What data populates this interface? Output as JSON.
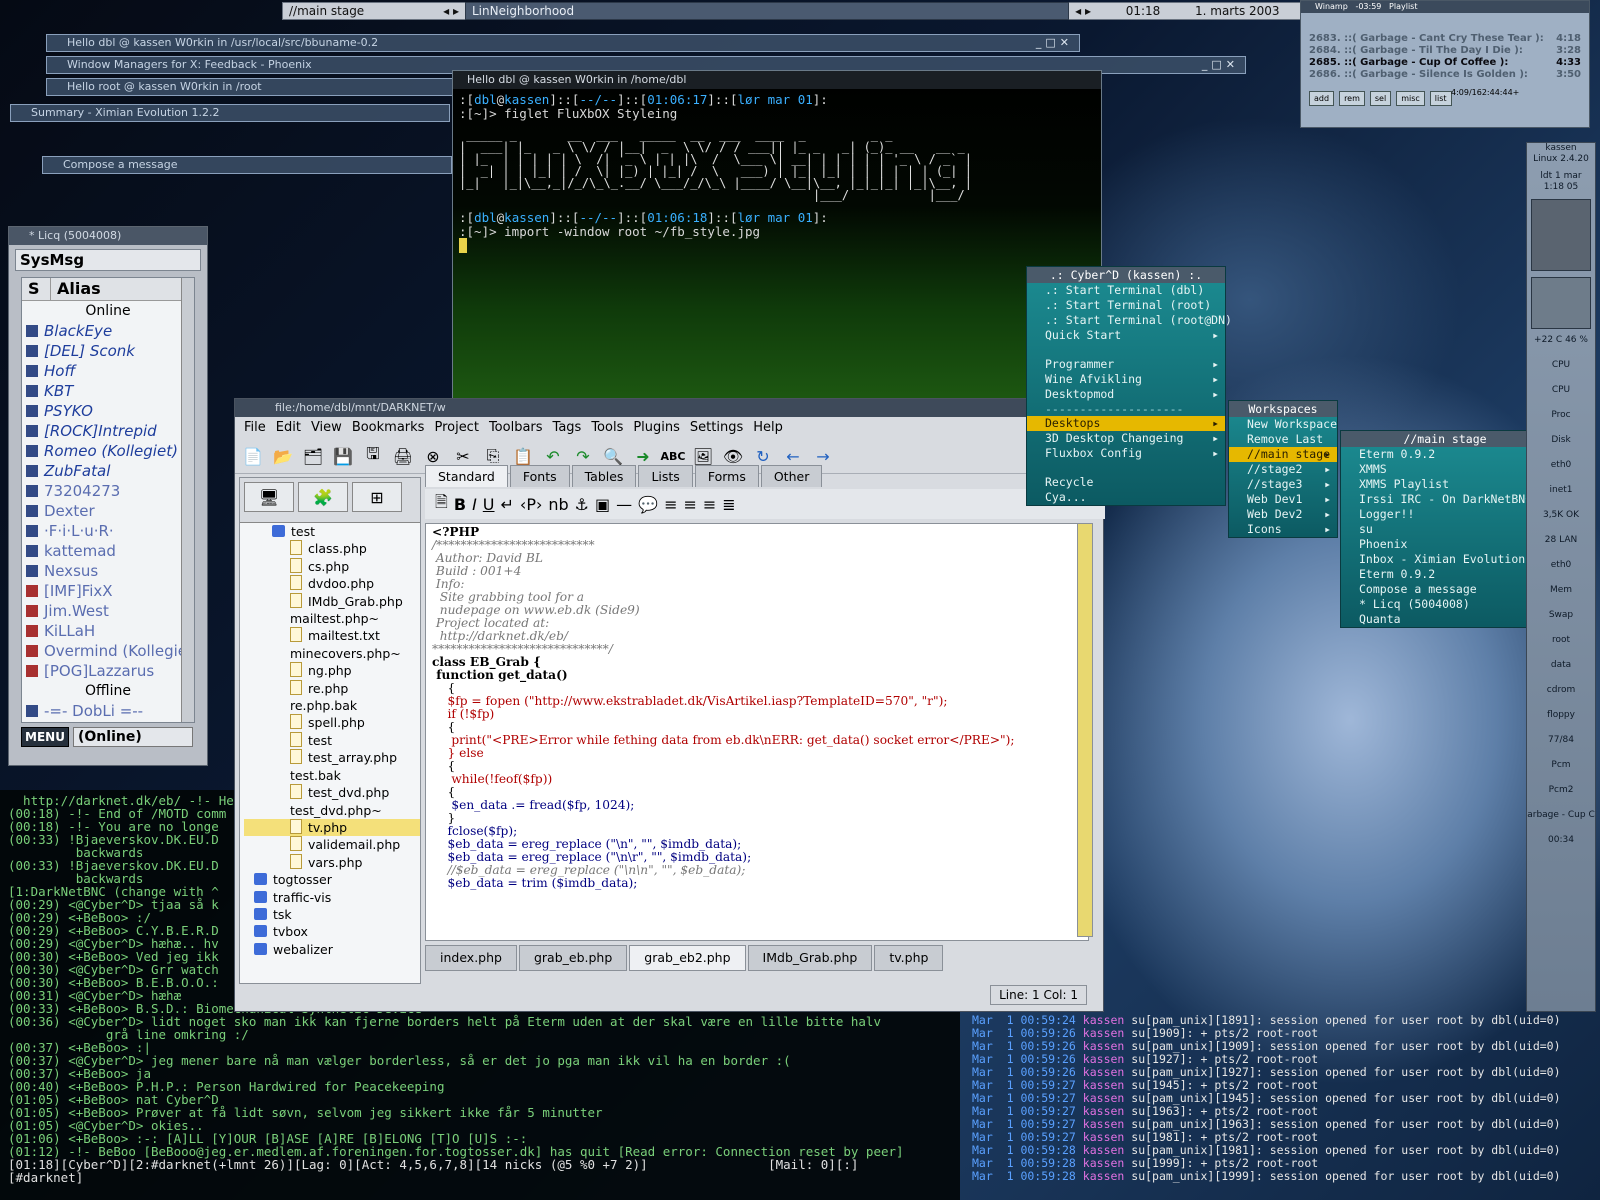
{
  "topbar": {
    "workspace": "//main stage",
    "left_arrow": "◂",
    "right_arrow": "▸",
    "window": "LinNeighborhood",
    "clock": "01:18",
    "date": "1. marts 2003"
  },
  "minimized": [
    "Hello dbl @ kassen W0rkin in  /usr/local/src/bbuname-0.2",
    "Window Managers for X: Feedback - Phoenix",
    "Hello root @ kassen W0rkin in  /root",
    "Summary - Ximian Evolution 1.2.2",
    "Compose a message"
  ],
  "terminal": {
    "title": "Hello dbl @ kassen W0rkin in  /home/dbl",
    "prompt1_user": "dbl",
    "prompt1_host": "kassen",
    "prompt1_dir": "--/--",
    "prompt1_time": "01:06:17",
    "prompt1_date": "lør mar 01",
    "cmd1": "figlet FluXbOX Styleing",
    "figlet": [
      " _____ _       __  ___   _____  __  ___  ____  _         _ _             ",
      "|  ___| |_   _ \\ \\/ / |__|  _  \\ \\/ / / ___|| |_ _   _| (_)_ __   __ _ ",
      "| |_  | | | | | \\  /| '_ \\ | | |\\  /  \\___ \\| __| | | | | | '_ \\ / _` |",
      "|  _| | | |_| | /  \\| |_) | |_| /  \\   ___) | |_| |_| | | | | | | (_| |",
      "|_|   |_|\\__,_|/_/\\_\\_.__/ \\___/_/\\_\\ |____/ \\__|\\__, |_|_|_| |_|\\__, |",
      "                                                 |___/           |___/ "
    ],
    "prompt2_time": "01:06:18",
    "cmd2": "import -window root ~/fb_style.jpg"
  },
  "licq": {
    "title": "* Licq (5004008)",
    "sysmsg": "SysMsg",
    "col_s": "S",
    "col_alias": "Alias",
    "online_label": "Online",
    "online": [
      "BlackEye",
      "[DEL] Sconk",
      "Hoff",
      "KBT",
      "PSYKO",
      "[ROCK]Intrepid",
      "Romeo (Kollegiet)",
      "ZubFatal"
    ],
    "offline_top": [
      "73204273",
      "Dexter",
      "·F·i·L·u·R·",
      "kattemad",
      "Nexsus",
      "[IMF]FixX",
      "Jim.West",
      "KiLLaH",
      "Overmind (Kollegie",
      "[POG]Lazzarus"
    ],
    "offline_label": "Offline",
    "offline": [
      "-=- DobLi =--"
    ],
    "menu": "MENU",
    "status": "(Online)"
  },
  "irc": {
    "lines": [
      "  http://darknet.dk/eb/ -!- He",
      "(00:18) -!- End of /MOTD comm",
      "(00:18) -!- You are no longe",
      "(00:33) !Bjaeverskov.DK.EU.D",
      "         backwards",
      "(00:33) !Bjaeverskov.DK.EU.D",
      "         backwards",
      "[1:DarkNetBNC (change with ^",
      "(00:29) <@Cyber^D> tjaa så k",
      "(00:29) <+BeBoo> :/",
      "(00:29) <+BeBoo> C.Y.B.E.R.D",
      "(00:29) <@Cyber^D> hæhæ.. hv",
      "(00:30) <+BeBoo> Ved jeg ikk",
      "(00:30) <@Cyber^D> Grr watch",
      "(00:30) <+BeBoo> B.E.B.O.O.:",
      "(00:31) <@Cyber^D> hæhæ",
      "(00:33) <+BeBoo> B.S.D.: Biomechanical Synthetic Device",
      "(00:36) <@Cyber^D> lidt noget sko man ikk kan fjerne borders helt på Eterm uden at der skal være en lille bitte halv",
      "             grå line omkring :/",
      "(00:37) <+BeBoo> :|",
      "(00:37) <@Cyber^D> jeg mener bare nå man vælger borderless, så er det jo pga man ikk vil ha en border :(",
      "(00:37) <+BeBoo> ja",
      "(00:40) <+BeBoo> P.H.P.: Person Hardwired for Peacekeeping",
      "(01:05) <+BeBoo> nat Cyber^D",
      "(01:05) <+BeBoo> Prøver at få lidt søvn, selvom jeg sikkert ikke får 5 minutter",
      "(01:05) <@Cyber^D> okies..",
      "(01:06) <+BeBoo> :-: [A]LL [Y]OUR [B]ASE [A]RE [B]ELONG [T]O [U]S :-:",
      "(01:12) -!- BeBoo [BeBooo@jeg.er.medlem.af.foreningen.for.togtosser.dk] has quit [Read error: Connection reset by peer]",
      "[01:18][Cyber^D][2:#darknet(+lmnt 26)][Lag: 0][Act: 4,5,6,7,8][14 nicks (@5 %0 +7 2)]                [Mail: 0][:]",
      "[#darknet] "
    ]
  },
  "syslog": {
    "lines": [
      {
        "d": "Mar  1 00:59:24",
        "h": "kassen",
        "p": " su[pam_unix][1891]: session opened for user root by dbl(uid=0)"
      },
      {
        "d": "Mar  1 00:59:26",
        "h": "kassen",
        "p": " su[1909]: + pts/2 root-root"
      },
      {
        "d": "Mar  1 00:59:26",
        "h": "kassen",
        "p": " su[pam_unix][1909]: session opened for user root by dbl(uid=0)"
      },
      {
        "d": "Mar  1 00:59:26",
        "h": "kassen",
        "p": " su[1927]: + pts/2 root-root"
      },
      {
        "d": "Mar  1 00:59:26",
        "h": "kassen",
        "p": " su[pam_unix][1927]: session opened for user root by dbl(uid=0)"
      },
      {
        "d": "Mar  1 00:59:27",
        "h": "kassen",
        "p": " su[1945]: + pts/2 root-root"
      },
      {
        "d": "Mar  1 00:59:27",
        "h": "kassen",
        "p": " su[pam_unix][1945]: session opened for user root by dbl(uid=0)"
      },
      {
        "d": "Mar  1 00:59:27",
        "h": "kassen",
        "p": " su[1963]: + pts/2 root-root"
      },
      {
        "d": "Mar  1 00:59:27",
        "h": "kassen",
        "p": " su[pam_unix][1963]: session opened for user root by dbl(uid=0)"
      },
      {
        "d": "Mar  1 00:59:27",
        "h": "kassen",
        "p": " su[1981]: + pts/2 root-root"
      },
      {
        "d": "Mar  1 00:59:28",
        "h": "kassen",
        "p": " su[pam_unix][1981]: session opened for user root by dbl(uid=0)"
      },
      {
        "d": "Mar  1 00:59:28",
        "h": "kassen",
        "p": " su[1999]: + pts/2 root-root"
      },
      {
        "d": "Mar  1 00:59:28",
        "h": "kassen",
        "p": " su[pam_unix][1999]: session opened for user root by dbl(uid=0)"
      }
    ]
  },
  "bluefish": {
    "title": "file:/home/dbl/mnt/DARKNET/w",
    "menus": [
      "File",
      "Edit",
      "View",
      "Bookmarks",
      "Project",
      "Toolbars",
      "Tags",
      "Tools",
      "Plugins",
      "Settings",
      "Help"
    ],
    "htmltabs": [
      "Standard",
      "Fonts",
      "Tables",
      "Lists",
      "Forms",
      "Other"
    ],
    "tree": [
      {
        "n": "test",
        "t": "dir"
      },
      {
        "n": "class.php"
      },
      {
        "n": "cs.php"
      },
      {
        "n": "dvdoo.php"
      },
      {
        "n": "IMdb_Grab.php"
      },
      {
        "n": "mailtest.php~",
        "t": "plain"
      },
      {
        "n": "mailtest.txt"
      },
      {
        "n": "minecovers.php~",
        "t": "plain"
      },
      {
        "n": "ng.php"
      },
      {
        "n": "re.php"
      },
      {
        "n": "re.php.bak",
        "t": "plain"
      },
      {
        "n": "spell.php"
      },
      {
        "n": "test"
      },
      {
        "n": "test_array.php"
      },
      {
        "n": "test.bak",
        "t": "plain"
      },
      {
        "n": "test_dvd.php"
      },
      {
        "n": "test_dvd.php~",
        "t": "plain"
      },
      {
        "n": "tv.php",
        "sel": true
      },
      {
        "n": "validemail.php"
      },
      {
        "n": "vars.php"
      },
      {
        "n": "togtosser",
        "t": "dir"
      },
      {
        "n": "traffic-vis",
        "t": "dir"
      },
      {
        "n": "tsk",
        "t": "dir"
      },
      {
        "n": "tvbox",
        "t": "dir"
      },
      {
        "n": "webalizer",
        "t": "dir"
      }
    ],
    "filetabs": [
      "index.php",
      "grab_eb.php",
      "grab_eb2.php",
      "IMdb_Grab.php",
      "tv.php"
    ],
    "active_file": "grab_eb2.php",
    "position": "Line: 1 Col: 1",
    "code": [
      {
        "c": "kw",
        "t": "<?PHP"
      },
      {
        "c": "cm",
        "t": "/**************************"
      },
      {
        "c": "cm",
        "t": " Author: David BL"
      },
      {
        "c": "cm",
        "t": " Build : 001+4"
      },
      {
        "c": "cm",
        "t": ""
      },
      {
        "c": "cm",
        "t": " Info:"
      },
      {
        "c": "cm",
        "t": "  Site grabbing tool for a"
      },
      {
        "c": "cm",
        "t": "  nudepage on www.eb.dk (Side9)"
      },
      {
        "c": "cm",
        "t": ""
      },
      {
        "c": "cm",
        "t": " Project located at:"
      },
      {
        "c": "cm",
        "t": "  http://darknet.dk/eb/"
      },
      {
        "c": "cm",
        "t": ""
      },
      {
        "c": "cm",
        "t": "*****************************/"
      },
      {
        "c": "kw",
        "t": "class EB_Grab {"
      },
      {
        "c": "kw",
        "t": " function get_data()"
      },
      {
        "c": "",
        "t": "    {"
      },
      {
        "c": "st",
        "t": "    $fp = fopen (\"http://www.ekstrabladet.dk/VisArtikel.iasp?TemplateID=570\", \"r\");"
      },
      {
        "c": "st",
        "t": "    if (!$fp)"
      },
      {
        "c": "",
        "t": "    {"
      },
      {
        "c": "st",
        "t": "     print(\"<PRE>Error while fething data from eb.dk\\nERR: get_data() socket error</PRE>\");"
      },
      {
        "c": "st",
        "t": "    } else"
      },
      {
        "c": "",
        "t": "    {"
      },
      {
        "c": "st",
        "t": "     while(!feof($fp))"
      },
      {
        "c": "",
        "t": "    {"
      },
      {
        "c": "fn",
        "t": "     $en_data .= fread($fp, 1024);"
      },
      {
        "c": "",
        "t": "    }"
      },
      {
        "c": "fn",
        "t": "    fclose($fp);"
      },
      {
        "c": "fn",
        "t": "    $eb_data = ereg_replace (\"\\n\", \"\", $imdb_data);"
      },
      {
        "c": "fn",
        "t": "    $eb_data = ereg_replace (\"\\n\\r\", \"\", $imdb_data);"
      },
      {
        "c": "cm",
        "t": "    //$eb_data = ereg_replace (\"\\n\\n\", \"\", $eb_data);"
      },
      {
        "c": "fn",
        "t": "    $eb_data = trim ($imdb_data);"
      }
    ]
  },
  "rootmenu": {
    "title": ".: Cyber^D (kassen) :.",
    "items": [
      {
        "l": ".: Start Terminal (dbl)"
      },
      {
        "l": ".: Start Terminal (root)"
      },
      {
        "l": ".: Start Terminal (root@DN)"
      },
      {
        "l": "Quick Start",
        "a": "▸"
      },
      {
        "sep": ""
      },
      {
        "l": "Programmer",
        "a": "▸"
      },
      {
        "l": "Wine Afvikling",
        "a": "▸"
      },
      {
        "l": "Desktopmod",
        "a": "▸"
      },
      {
        "sep": "--------------------"
      },
      {
        "l": "Desktops",
        "a": "▸",
        "sel": true
      },
      {
        "l": "3D Desktop Changeing",
        "a": "▸"
      },
      {
        "l": "Fluxbox Config",
        "a": "▸"
      },
      {
        "sep": ""
      },
      {
        "l": "Recycle"
      },
      {
        "l": "Cya..."
      }
    ]
  },
  "wsmenu": {
    "title": "Workspaces",
    "items": [
      {
        "l": "New Workspace"
      },
      {
        "l": "Remove Last"
      },
      {
        "l": "//main stage",
        "a": "▸",
        "sel": true
      },
      {
        "l": "//stage2",
        "a": "▸"
      },
      {
        "l": "//stage3",
        "a": "▸"
      },
      {
        "l": "Web Dev1",
        "a": "▸"
      },
      {
        "l": "Web Dev2",
        "a": "▸"
      },
      {
        "l": "Icons",
        "a": "▸"
      }
    ]
  },
  "stagemenu": {
    "title": "//main stage",
    "items": [
      {
        "l": "Eterm 0.9.2"
      },
      {
        "l": "XMMS"
      },
      {
        "l": "XMMS Playlist"
      },
      {
        "l": "Irssi IRC - On DarkNetBNC"
      },
      {
        "l": "Logger!!"
      },
      {
        "l": "su"
      },
      {
        "l": "Phoenix"
      },
      {
        "l": "Inbox - Ximian Evolution 1.2.2"
      },
      {
        "l": "Eterm 0.9.2"
      },
      {
        "l": "Compose a message"
      },
      {
        "l": "* Licq (5004008)"
      },
      {
        "l": "Quanta"
      }
    ]
  },
  "winamp": {
    "title": "Winamp",
    "timer": "-03:59",
    "playlist_label": "Playlist",
    "tracks": [
      {
        "t": "2683. ::( Garbage - Cant Cry These Tear ):",
        "d": "4:18"
      },
      {
        "t": "2684. ::( Garbage - Til The Day I Die ):",
        "d": "3:28"
      },
      {
        "t": "2685. ::( Garbage - Cup Of Coffee ):",
        "d": "4:33",
        "on": true
      },
      {
        "t": "2686. ::( Garbage - Silence Is Golden ):",
        "d": "3:50"
      }
    ],
    "buttons": [
      "add",
      "rem",
      "sel",
      "misc",
      "list"
    ],
    "info": "4:09/162:44:44+"
  },
  "gkrellm": {
    "host": "kassen",
    "kernel": "Linux 2.4.20",
    "uptime_lbl": "ldt",
    "date": "1 mar",
    "time": "1:18 05",
    "temp": "+22 C",
    "load": "46 %",
    "labels": [
      "CPU",
      "CPU",
      "Proc",
      "Disk",
      "eth0",
      "inet1",
      "3,5K OK",
      "28 LAN",
      "eth0",
      "Mem",
      "Swap",
      "root",
      "data",
      "cdrom",
      "floppy",
      "77/84",
      "Pcm",
      "Pcm2",
      "arbage - Cup C",
      "00:34"
    ]
  }
}
